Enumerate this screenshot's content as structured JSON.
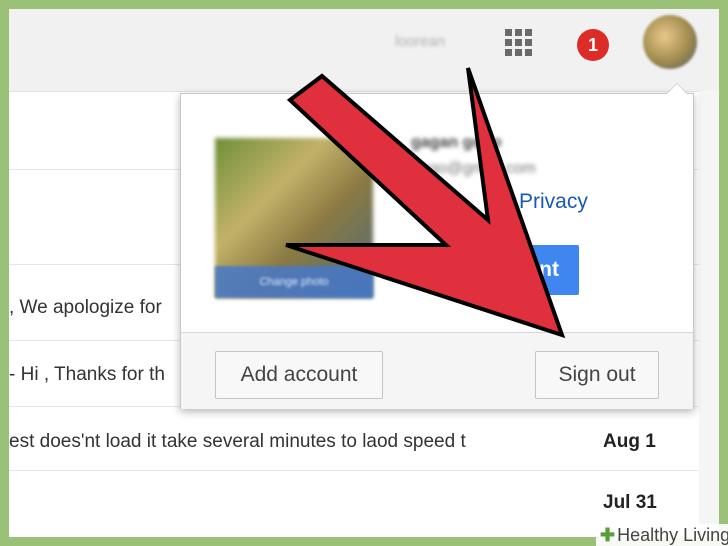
{
  "header": {
    "username": "loorean",
    "notification_count": "1"
  },
  "mail": {
    "rows": [
      {
        "snippet": ", We apologize for",
        "date": ""
      },
      {
        "snippet": " - Hi , Thanks for th",
        "date": ""
      },
      {
        "snippet": "est does'nt load it take several minutes to laod speed t",
        "date": "Aug 1"
      },
      {
        "snippet": "",
        "date": "Jul 31"
      }
    ]
  },
  "account_popup": {
    "name": "gagan gogo",
    "email": "gogo@gmail.com",
    "change_photo_label": "Change photo",
    "privacy_link": "Privacy",
    "my_account_button": "nt",
    "add_account_button": "Add account",
    "sign_out_button": "Sign out"
  },
  "overlay": {
    "arrow_color": "#e02f3d",
    "watermark": "Healthy Living"
  }
}
